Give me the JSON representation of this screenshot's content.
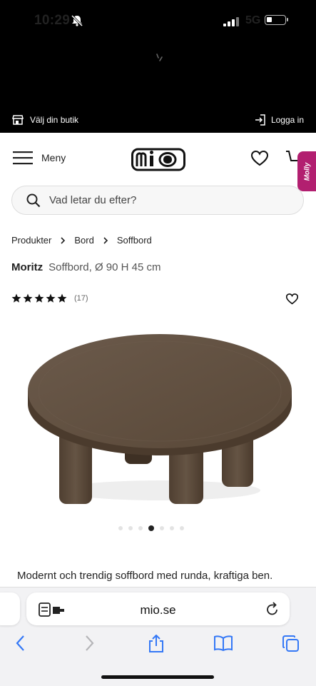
{
  "status": {
    "time": "10:29",
    "network": "5G"
  },
  "topbar": {
    "store": "Välj din butik",
    "login": "Logga in"
  },
  "header": {
    "menu": "Meny",
    "logo_text": "mio",
    "chat_badge": "Molly"
  },
  "search": {
    "placeholder": "Vad letar du efter?"
  },
  "breadcrumb": [
    "Produkter",
    "Bord",
    "Soffbord"
  ],
  "product": {
    "name": "Moritz",
    "subtitle": "Soffbord, Ø 90 H 45 cm",
    "rating": 5,
    "reviews": "(17)",
    "description": "Modernt och trendig soffbord med runda, kraftiga ben.",
    "gallery": {
      "count": 7,
      "active": 3
    }
  },
  "browser": {
    "url": "mio.se"
  },
  "colors": {
    "accent": "#b21f70",
    "wood": "#5b4a3c"
  }
}
